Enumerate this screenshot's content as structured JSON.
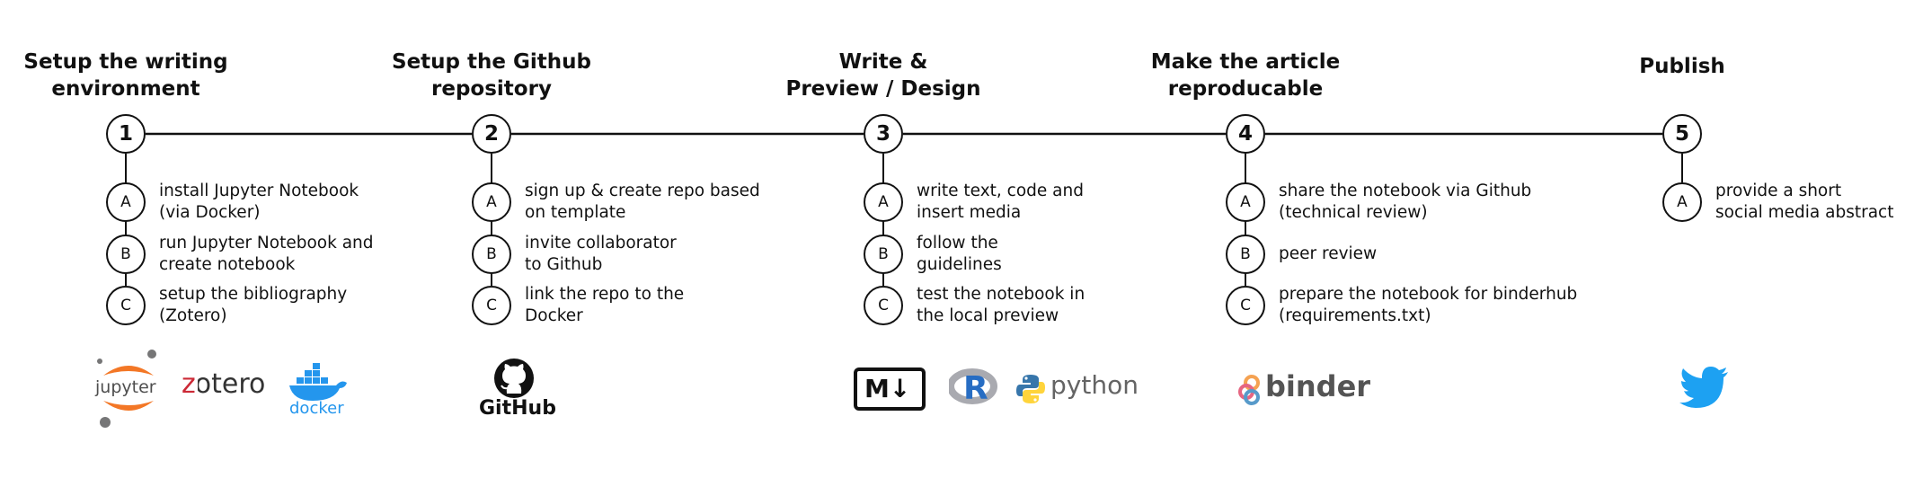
{
  "steps": [
    {
      "number": "1",
      "title_lines": [
        "Setup the writing",
        "environment"
      ],
      "substeps": [
        {
          "letter": "A",
          "lines": [
            "install Jupyter Notebook",
            "(via Docker)"
          ]
        },
        {
          "letter": "B",
          "lines": [
            "run Jupyter Notebook and",
            "create notebook"
          ]
        },
        {
          "letter": "C",
          "lines": [
            "setup the bibliography",
            "(Zotero)"
          ]
        }
      ]
    },
    {
      "number": "2",
      "title_lines": [
        "Setup the Github",
        "repository"
      ],
      "substeps": [
        {
          "letter": "A",
          "lines": [
            "sign up & create repo based",
            "on template"
          ]
        },
        {
          "letter": "B",
          "lines": [
            "invite collaborator",
            "to Github"
          ]
        },
        {
          "letter": "C",
          "lines": [
            "link the repo to the",
            "Docker"
          ]
        }
      ]
    },
    {
      "number": "3",
      "title_lines": [
        "Write &",
        "Preview / Design"
      ],
      "substeps": [
        {
          "letter": "A",
          "lines": [
            "write text, code and",
            "insert media"
          ]
        },
        {
          "letter": "B",
          "lines": [
            "follow the",
            "guidelines"
          ]
        },
        {
          "letter": "C",
          "lines": [
            "test the notebook in",
            "the local preview"
          ]
        }
      ]
    },
    {
      "number": "4",
      "title_lines": [
        "Make the article",
        "reproducable"
      ],
      "substeps": [
        {
          "letter": "A",
          "lines": [
            "share the notebook via Github",
            "(technical review)"
          ]
        },
        {
          "letter": "B",
          "lines": [
            "peer review"
          ]
        },
        {
          "letter": "C",
          "lines": [
            "prepare the notebook for binderhub",
            "(requirements.txt)"
          ]
        }
      ]
    },
    {
      "number": "5",
      "title_lines": [
        "Publish"
      ],
      "substeps": [
        {
          "letter": "A",
          "lines": [
            "provide a short",
            "social media abstract"
          ]
        }
      ]
    }
  ],
  "logos": {
    "jupyter": {
      "text": "jupyter",
      "icon": "jupyter-logo",
      "color": "#F37726",
      "dot_color": "#767677"
    },
    "zotero": {
      "text": "zotero",
      "icon": "zotero-logo",
      "accent": "#CC2936"
    },
    "docker": {
      "text": "docker",
      "icon": "docker-whale-logo",
      "color": "#2496ED"
    },
    "github": {
      "text": "GitHub",
      "icon": "github-octocat-logo",
      "color": "#111111"
    },
    "markdown": {
      "text": "M↓",
      "icon": "markdown-logo",
      "color": "#111111"
    },
    "r": {
      "text": "R",
      "icon": "r-logo",
      "color": "#276DC3",
      "ring_color": "#A9AAB0"
    },
    "python": {
      "text": "python",
      "icon": "python-logo",
      "blue": "#3776AB",
      "yellow": "#FFD43B",
      "text_color": "#646464"
    },
    "binder": {
      "text": "binder",
      "icon": "binder-logo",
      "text_color": "#545454",
      "colors": [
        "#F5A252",
        "#E66581",
        "#579ACA"
      ]
    },
    "twitter": {
      "icon": "twitter-bird-logo",
      "color": "#1DA1F2"
    }
  },
  "colors": {
    "line": "#111111",
    "background": "#ffffff"
  }
}
